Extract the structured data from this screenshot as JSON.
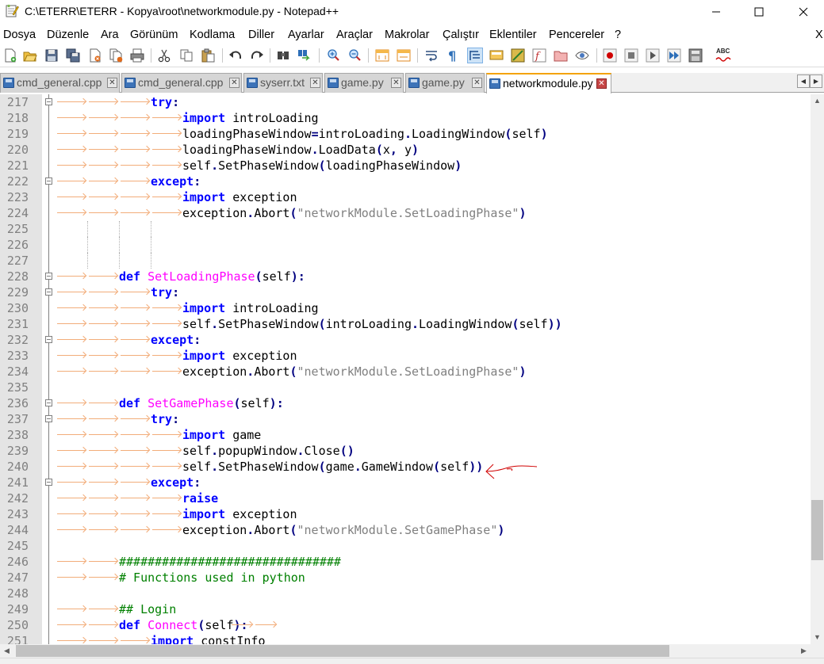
{
  "window": {
    "title": "C:\\ETERR\\ETERR - Kopya\\root\\networkmodule.py - Notepad++",
    "controls": {
      "minimize": "—",
      "maximize": "☐",
      "close": "✕"
    }
  },
  "menu": {
    "items": [
      "Dosya",
      "Düzenle",
      "Ara",
      "Görünüm",
      "Kodlama",
      "Diller",
      "Ayarlar",
      "Araçlar",
      "Makrolar",
      "Çalıştır",
      "Eklentiler",
      "Pencereler",
      "?"
    ],
    "close_label": "X"
  },
  "toolbar": {
    "spellcheck_label": "ABC"
  },
  "tabs": [
    {
      "label": "cmd_general.cpp",
      "active": false
    },
    {
      "label": "cmd_general.cpp",
      "active": false
    },
    {
      "label": "syserr.txt",
      "active": false
    },
    {
      "label": "game.py",
      "active": false
    },
    {
      "label": "game.py",
      "active": false
    },
    {
      "label": "networkmodule.py",
      "active": true
    }
  ],
  "tab_close_glyph": "✕",
  "tab_nav": {
    "prev": "◀",
    "next": "▶"
  },
  "colors": {
    "keyword": "#0000ff",
    "function_name": "#ff00ff",
    "string": "#808080",
    "comment": "#008000",
    "tab_arrow": "#f2ad7a",
    "active_tab_accent": "#f4a300",
    "annotation_arrow": "#d00000"
  },
  "code": {
    "lines": [
      {
        "n": "217",
        "tokens": [
          {
            "t": "try",
            "c": "kw"
          },
          {
            "t": ":",
            "c": "op"
          }
        ]
      },
      {
        "n": "218",
        "tokens": [
          {
            "t": "import",
            "c": "kw"
          },
          {
            "t": " introLoading",
            "c": ""
          }
        ]
      },
      {
        "n": "219",
        "tokens": [
          {
            "t": "loadingPhaseWindow",
            "c": ""
          },
          {
            "t": "=",
            "c": "op"
          },
          {
            "t": "introLoading",
            "c": ""
          },
          {
            "t": ".",
            "c": "op"
          },
          {
            "t": "LoadingWindow",
            "c": ""
          },
          {
            "t": "(",
            "c": "op"
          },
          {
            "t": "self",
            "c": ""
          },
          {
            "t": ")",
            "c": "op"
          }
        ]
      },
      {
        "n": "220",
        "tokens": [
          {
            "t": "loadingPhaseWindow",
            "c": ""
          },
          {
            "t": ".",
            "c": "op"
          },
          {
            "t": "LoadData",
            "c": ""
          },
          {
            "t": "(",
            "c": "op"
          },
          {
            "t": "x",
            "c": ""
          },
          {
            "t": ", ",
            "c": "op"
          },
          {
            "t": "y",
            "c": ""
          },
          {
            "t": ")",
            "c": "op"
          }
        ]
      },
      {
        "n": "221",
        "tokens": [
          {
            "t": "self",
            "c": ""
          },
          {
            "t": ".",
            "c": "op"
          },
          {
            "t": "SetPhaseWindow",
            "c": ""
          },
          {
            "t": "(",
            "c": "op"
          },
          {
            "t": "loadingPhaseWindow",
            "c": ""
          },
          {
            "t": ")",
            "c": "op"
          }
        ]
      },
      {
        "n": "222",
        "tokens": [
          {
            "t": "except",
            "c": "kw"
          },
          {
            "t": ":",
            "c": "op"
          }
        ]
      },
      {
        "n": "223",
        "tokens": [
          {
            "t": "import",
            "c": "kw"
          },
          {
            "t": " exception",
            "c": ""
          }
        ]
      },
      {
        "n": "224",
        "tokens": [
          {
            "t": "exception",
            "c": ""
          },
          {
            "t": ".",
            "c": "op"
          },
          {
            "t": "Abort",
            "c": ""
          },
          {
            "t": "(",
            "c": "op"
          },
          {
            "t": "\"networkModule.SetLoadingPhase\"",
            "c": "str"
          },
          {
            "t": ")",
            "c": "op"
          }
        ]
      },
      {
        "n": "225",
        "tokens": []
      },
      {
        "n": "226",
        "tokens": []
      },
      {
        "n": "227",
        "tokens": []
      },
      {
        "n": "228",
        "tokens": [
          {
            "t": "def",
            "c": "kw"
          },
          {
            "t": " ",
            "c": ""
          },
          {
            "t": "SetLoadingPhase",
            "c": "fn"
          },
          {
            "t": "(",
            "c": "op"
          },
          {
            "t": "self",
            "c": ""
          },
          {
            "t": ")",
            "c": "op"
          },
          {
            "t": ":",
            "c": "op"
          }
        ]
      },
      {
        "n": "229",
        "tokens": [
          {
            "t": "try",
            "c": "kw"
          },
          {
            "t": ":",
            "c": "op"
          }
        ]
      },
      {
        "n": "230",
        "tokens": [
          {
            "t": "import",
            "c": "kw"
          },
          {
            "t": " introLoading",
            "c": ""
          }
        ]
      },
      {
        "n": "231",
        "tokens": [
          {
            "t": "self",
            "c": ""
          },
          {
            "t": ".",
            "c": "op"
          },
          {
            "t": "SetPhaseWindow",
            "c": ""
          },
          {
            "t": "(",
            "c": "op"
          },
          {
            "t": "introLoading",
            "c": ""
          },
          {
            "t": ".",
            "c": "op"
          },
          {
            "t": "LoadingWindow",
            "c": ""
          },
          {
            "t": "(",
            "c": "op"
          },
          {
            "t": "self",
            "c": ""
          },
          {
            "t": "))",
            "c": "op"
          }
        ]
      },
      {
        "n": "232",
        "tokens": [
          {
            "t": "except",
            "c": "kw"
          },
          {
            "t": ":",
            "c": "op"
          }
        ]
      },
      {
        "n": "233",
        "tokens": [
          {
            "t": "import",
            "c": "kw"
          },
          {
            "t": " exception",
            "c": ""
          }
        ]
      },
      {
        "n": "234",
        "tokens": [
          {
            "t": "exception",
            "c": ""
          },
          {
            "t": ".",
            "c": "op"
          },
          {
            "t": "Abort",
            "c": ""
          },
          {
            "t": "(",
            "c": "op"
          },
          {
            "t": "\"networkModule.SetLoadingPhase\"",
            "c": "str"
          },
          {
            "t": ")",
            "c": "op"
          }
        ]
      },
      {
        "n": "235",
        "tokens": []
      },
      {
        "n": "236",
        "tokens": [
          {
            "t": "def",
            "c": "kw"
          },
          {
            "t": " ",
            "c": ""
          },
          {
            "t": "SetGamePhase",
            "c": "fn"
          },
          {
            "t": "(",
            "c": "op"
          },
          {
            "t": "self",
            "c": ""
          },
          {
            "t": ")",
            "c": "op"
          },
          {
            "t": ":",
            "c": "op"
          }
        ]
      },
      {
        "n": "237",
        "tokens": [
          {
            "t": "try",
            "c": "kw"
          },
          {
            "t": ":",
            "c": "op"
          }
        ]
      },
      {
        "n": "238",
        "tokens": [
          {
            "t": "import",
            "c": "kw"
          },
          {
            "t": " game",
            "c": ""
          }
        ]
      },
      {
        "n": "239",
        "tokens": [
          {
            "t": "self",
            "c": ""
          },
          {
            "t": ".",
            "c": "op"
          },
          {
            "t": "popupWindow",
            "c": ""
          },
          {
            "t": ".",
            "c": "op"
          },
          {
            "t": "Close",
            "c": ""
          },
          {
            "t": "()",
            "c": "op"
          }
        ]
      },
      {
        "n": "240",
        "tokens": [
          {
            "t": "self",
            "c": ""
          },
          {
            "t": ".",
            "c": "op"
          },
          {
            "t": "SetPhaseWindow",
            "c": ""
          },
          {
            "t": "(",
            "c": "op"
          },
          {
            "t": "game",
            "c": ""
          },
          {
            "t": ".",
            "c": "op"
          },
          {
            "t": "GameWindow",
            "c": ""
          },
          {
            "t": "(",
            "c": "op"
          },
          {
            "t": "self",
            "c": ""
          },
          {
            "t": "))",
            "c": "op"
          }
        ]
      },
      {
        "n": "241",
        "tokens": [
          {
            "t": "except",
            "c": "kw"
          },
          {
            "t": ":",
            "c": "op"
          }
        ]
      },
      {
        "n": "242",
        "tokens": [
          {
            "t": "raise",
            "c": "kw"
          }
        ]
      },
      {
        "n": "243",
        "tokens": [
          {
            "t": "import",
            "c": "kw"
          },
          {
            "t": " exception",
            "c": ""
          }
        ]
      },
      {
        "n": "244",
        "tokens": [
          {
            "t": "exception",
            "c": ""
          },
          {
            "t": ".",
            "c": "op"
          },
          {
            "t": "Abort",
            "c": ""
          },
          {
            "t": "(",
            "c": "op"
          },
          {
            "t": "\"networkModule.SetGamePhase\"",
            "c": "str"
          },
          {
            "t": ")",
            "c": "op"
          }
        ]
      },
      {
        "n": "245",
        "tokens": []
      },
      {
        "n": "246",
        "tokens": [
          {
            "t": "###############################",
            "c": "cm"
          }
        ]
      },
      {
        "n": "247",
        "tokens": [
          {
            "t": "# Functions used in python",
            "c": "cm"
          }
        ]
      },
      {
        "n": "248",
        "tokens": []
      },
      {
        "n": "249",
        "tokens": [
          {
            "t": "## Login",
            "c": "cm"
          }
        ]
      },
      {
        "n": "250",
        "tokens": [
          {
            "t": "def",
            "c": "kw"
          },
          {
            "t": " ",
            "c": ""
          },
          {
            "t": "Connect",
            "c": "fn"
          },
          {
            "t": "(",
            "c": "op"
          },
          {
            "t": "self",
            "c": ""
          },
          {
            "t": ")",
            "c": "op"
          },
          {
            "t": ":",
            "c": "op"
          }
        ]
      },
      {
        "n": "251",
        "tokens": [
          {
            "t": "import",
            "c": "kw"
          },
          {
            "t": " constInfo",
            "c": ""
          }
        ]
      }
    ]
  }
}
